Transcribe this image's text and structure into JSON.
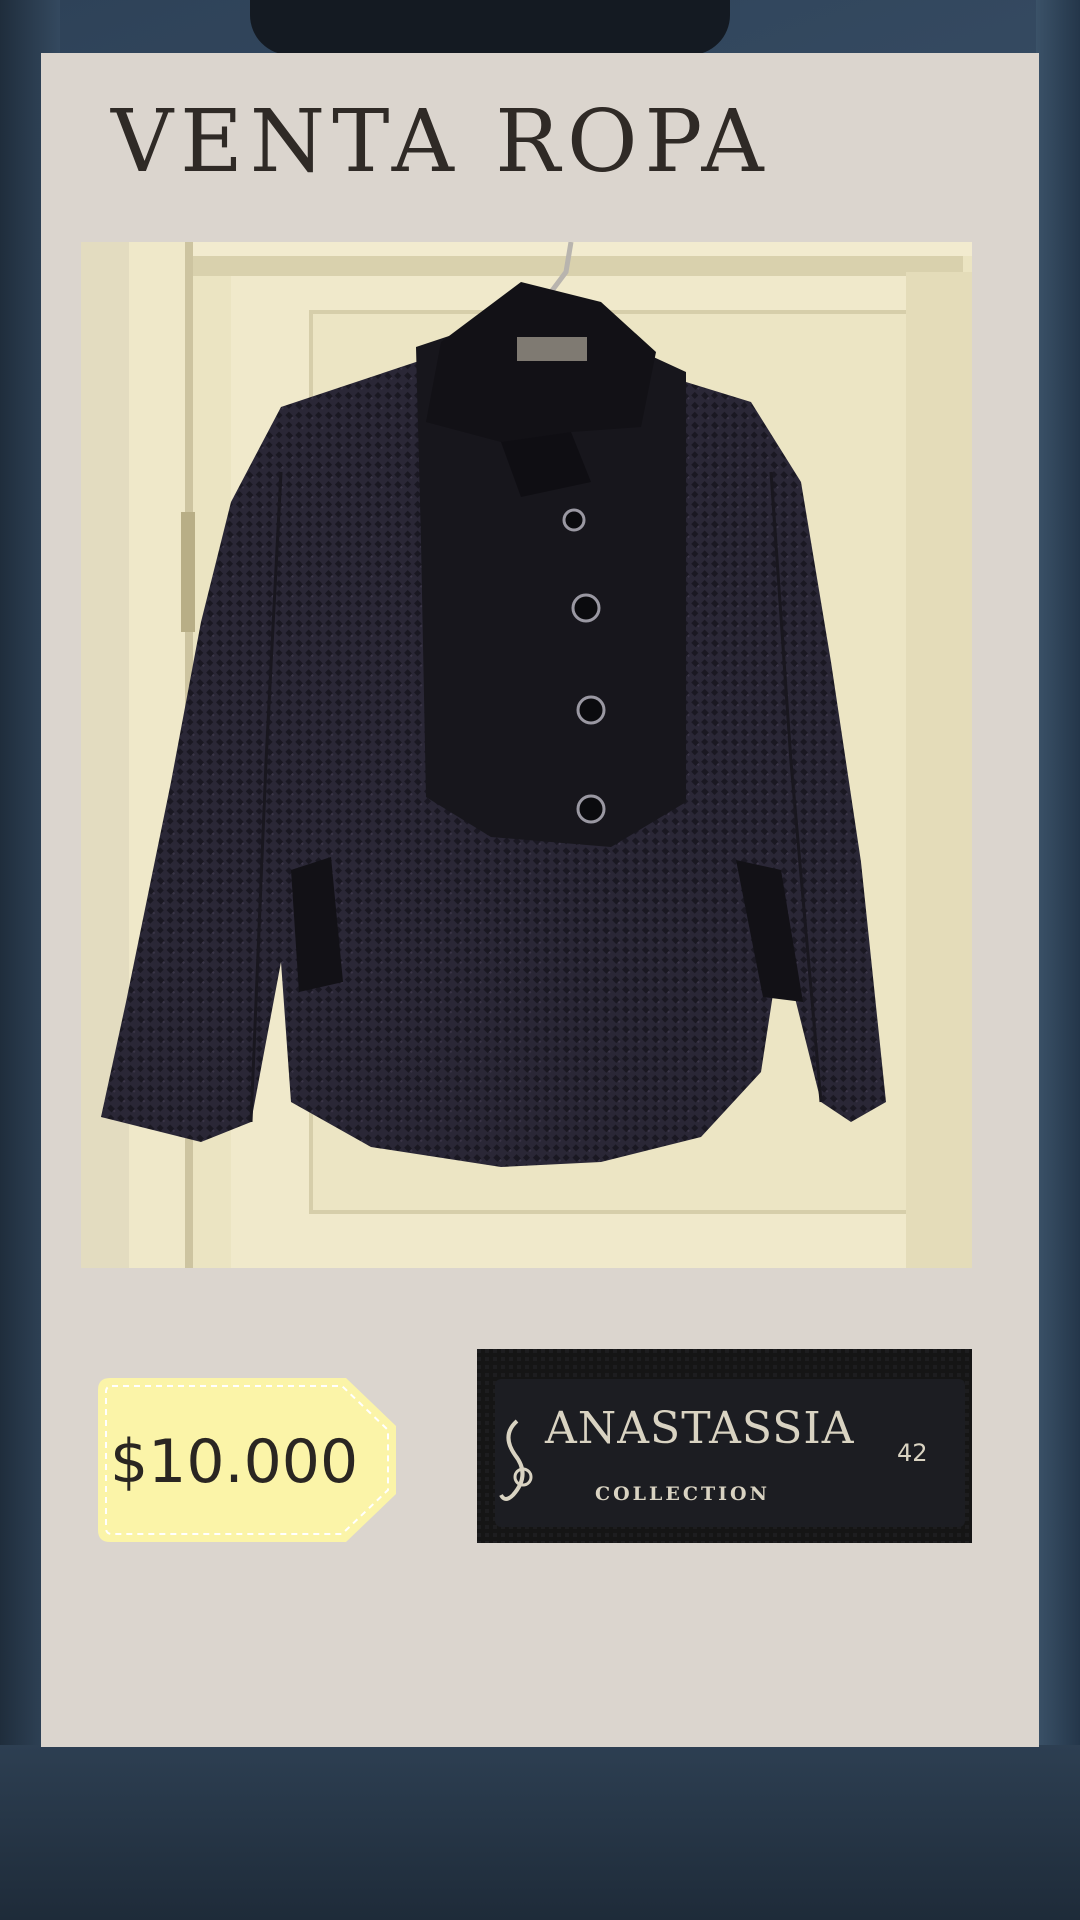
{
  "header": {
    "title": "VENTA ROPA"
  },
  "product_photo": {
    "subject": "jacket-on-hanger"
  },
  "price": {
    "label": "$10.000"
  },
  "brand_label": {
    "name": "ANASTASSIA",
    "subtitle": "COLLECTION",
    "size": "42"
  },
  "colors": {
    "card": "#dbd5ce",
    "tag": "#fbf4a8",
    "title": "#2f2a26",
    "background": "#34495f"
  }
}
